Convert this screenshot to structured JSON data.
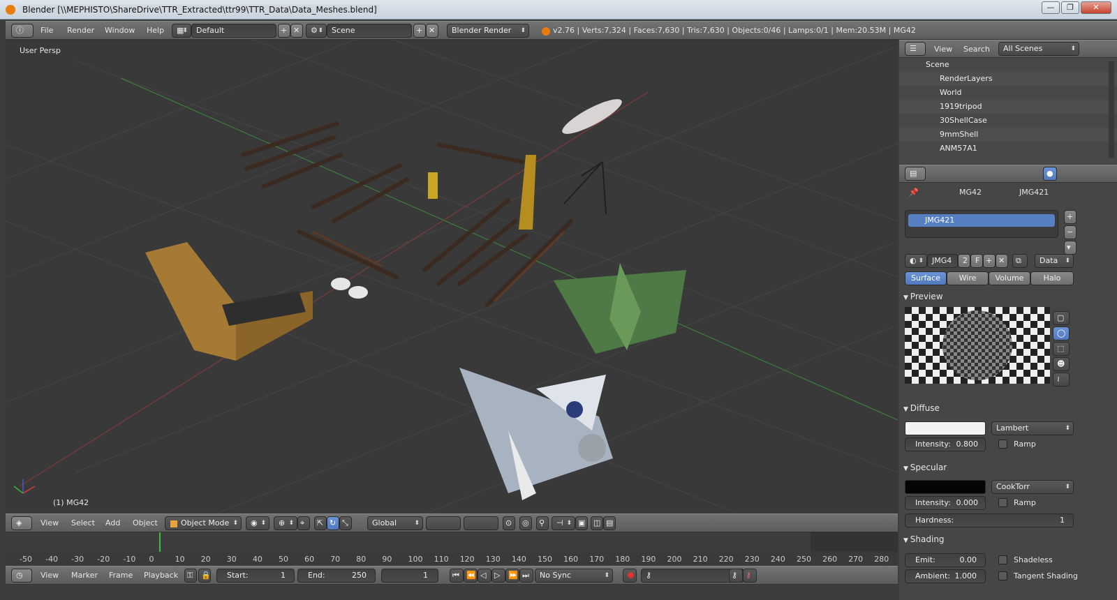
{
  "window": {
    "title": "Blender [\\\\MEPHISTO\\ShareDrive\\TTR_Extracted\\ttr99\\TTR_Data\\Data_Meshes.blend]",
    "min_label": "—",
    "max_label": "❐",
    "close_label": "✕"
  },
  "info_header": {
    "menus": [
      "File",
      "Render",
      "Window",
      "Help"
    ],
    "screen_layout": "Default",
    "scene": "Scene",
    "render_engine": "Blender Render",
    "stats": "v2.76 | Verts:7,324 | Faces:7,630 | Tris:7,630 | Objects:0/46 | Lamps:0/1 | Mem:20.53M | MG42"
  },
  "viewport": {
    "view_name": "User Persp",
    "active_object": "(1) MG42"
  },
  "view3d_header": {
    "menus": [
      "View",
      "Select",
      "Add",
      "Object"
    ],
    "mode": "Object Mode",
    "orientation": "Global"
  },
  "outliner": {
    "menus": [
      "View",
      "Search"
    ],
    "display_mode": "All Scenes",
    "rows": [
      {
        "label": "Scene",
        "indent": 0
      },
      {
        "label": "RenderLayers",
        "indent": 1
      },
      {
        "label": "World",
        "indent": 1
      },
      {
        "label": "1919tripod",
        "indent": 1
      },
      {
        "label": "30ShellCase",
        "indent": 1
      },
      {
        "label": "9mmShell",
        "indent": 1
      },
      {
        "label": "ANM57A1",
        "indent": 1
      }
    ]
  },
  "properties": {
    "breadcrumb": [
      "MG42",
      "JMG421"
    ],
    "material_slot": "JMG421",
    "datablock_name": "JMG4",
    "user_count": "2",
    "fake_user": "F",
    "data_link": "Data",
    "tabs": [
      "Surface",
      "Wire",
      "Volume",
      "Halo"
    ],
    "active_tab": "Surface",
    "preview_title": "Preview",
    "diffuse": {
      "title": "Diffuse",
      "color": "#f2f2f2",
      "shader": "Lambert",
      "intensity_label": "Intensity:",
      "intensity": "0.800",
      "ramp": "Ramp"
    },
    "specular": {
      "title": "Specular",
      "color": "#050505",
      "shader": "CookTorr",
      "intensity_label": "Intensity:",
      "intensity": "0.000",
      "ramp": "Ramp",
      "hardness_label": "Hardness:",
      "hardness": "1"
    },
    "shading": {
      "title": "Shading",
      "emit_label": "Emit:",
      "emit": "0.00",
      "shadeless": "Shadeless",
      "ambient_label": "Ambient:",
      "ambient": "1.000",
      "tangent": "Tangent Shading"
    }
  },
  "timeline": {
    "ticks": [
      "-50",
      "-40",
      "-30",
      "-20",
      "-10",
      "0",
      "10",
      "20",
      "30",
      "40",
      "50",
      "60",
      "70",
      "80",
      "90",
      "100",
      "110",
      "120",
      "130",
      "140",
      "150",
      "160",
      "170",
      "180",
      "190",
      "200",
      "210",
      "220",
      "230",
      "240",
      "250",
      "260",
      "270",
      "280"
    ],
    "current_frame": "1",
    "start_label": "Start:",
    "start": "1",
    "end_label": "End:",
    "end": "250",
    "menus": [
      "View",
      "Marker",
      "Frame",
      "Playback"
    ],
    "sync": "No Sync"
  },
  "colors": {
    "accent": "#5680c2",
    "frame_cursor": "#3dc13d",
    "blender_orange": "#e87d0d"
  }
}
